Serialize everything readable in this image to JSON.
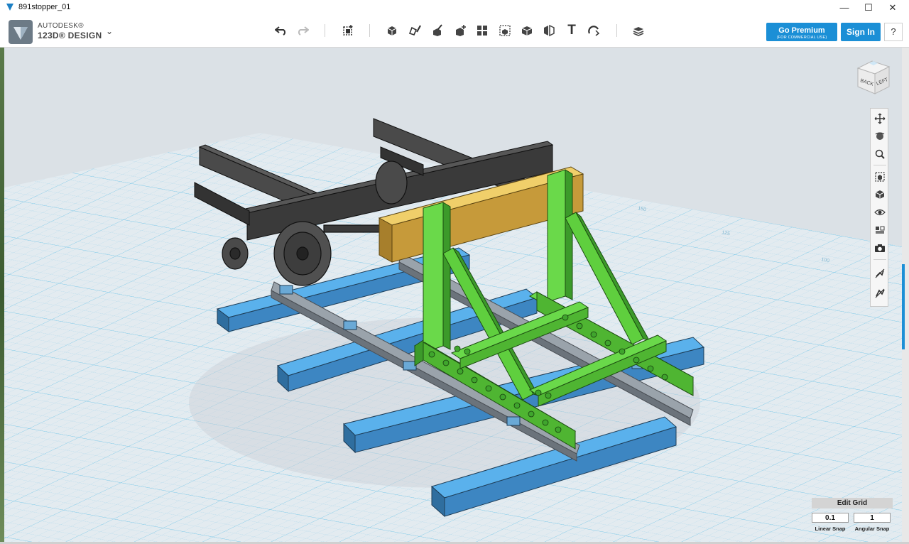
{
  "window": {
    "title": "891stopper_01",
    "controls": {
      "minimize": "—",
      "maximize": "☐",
      "close": "✕"
    }
  },
  "brand": {
    "line1": "AUTODESK®",
    "line2": "123D® DESIGN",
    "menu_caret": "⌄"
  },
  "toolbar": {
    "tools": [
      "undo-icon",
      "redo-icon",
      "transform-icon",
      "primitives-icon",
      "sketch-icon",
      "construct-icon",
      "modify-icon",
      "pattern-icon",
      "grouping-icon",
      "combine-icon",
      "measure-icon",
      "text-icon",
      "snap-icon",
      "material-icon"
    ],
    "text_tool_glyph": "T"
  },
  "account": {
    "premium_label": "Go Premium",
    "premium_sub": "(FOR COMMERCIAL USE)",
    "signin_label": "Sign In",
    "help_label": "?"
  },
  "viewcube": {
    "face_front": "BACK",
    "face_right": "LEFT"
  },
  "navbar": {
    "tools": [
      "pan-icon",
      "orbit-icon",
      "zoom-icon",
      "fit-icon",
      "view-icon",
      "visibility-icon",
      "material-view-icon",
      "screenshot-icon",
      "snap-off-icon",
      "snap-grid-icon"
    ]
  },
  "grid_labels": [
    "150",
    "125",
    "100"
  ],
  "edit_grid": {
    "title": "Edit Grid",
    "linear_value": "0.1",
    "angular_value": "1",
    "linear_label": "Linear Snap",
    "angular_label": "Angular Snap"
  },
  "colors": {
    "accent": "#1b8fd6",
    "sleeper_blue": "#4ea4e2",
    "stopper_green": "#5fcf3e",
    "buffer_yellow": "#e2bb4c",
    "chassis_dark": "#3b3b3b",
    "grid_line": "#7ac8e8"
  }
}
